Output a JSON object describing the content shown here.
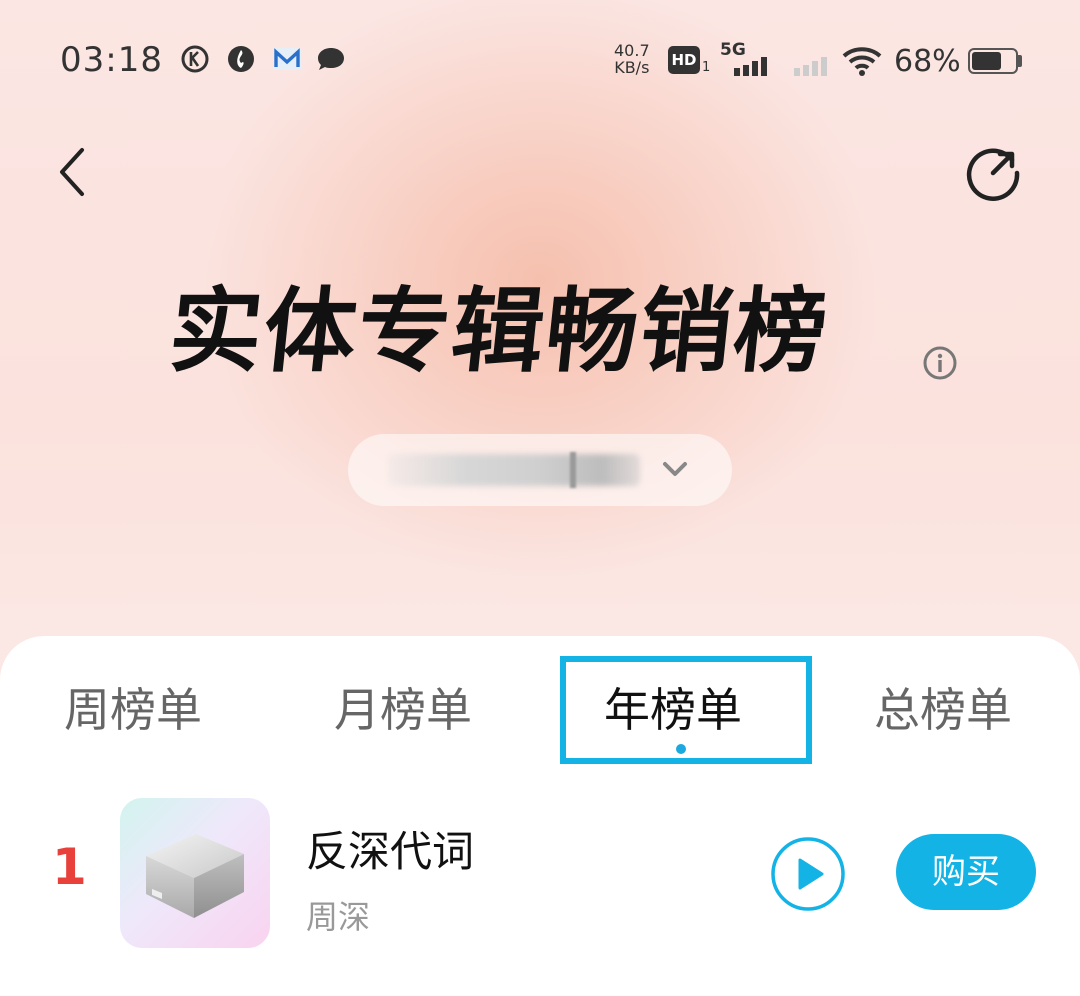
{
  "status_bar": {
    "time": "03:18",
    "net_speed_value": "40.7",
    "net_speed_unit": "KB/s",
    "hd_label": "HD",
    "hd_sub": "1",
    "network_type": "5G",
    "battery_percent": "68%",
    "battery_level": 0.68,
    "notification_icons": [
      "k-circle-icon",
      "flame-icon",
      "mail-m-icon",
      "chat-bubble-icon"
    ]
  },
  "header": {
    "title": "实体专辑畅销榜",
    "back_icon": "chevron-left-icon",
    "share_icon": "share-arrow-icon",
    "info_icon": "info-icon"
  },
  "selector": {
    "value": "",
    "chevron_icon": "chevron-down-icon"
  },
  "tabs": [
    {
      "label": "周榜单",
      "active": false
    },
    {
      "label": "月榜单",
      "active": false
    },
    {
      "label": "年榜单",
      "active": true
    },
    {
      "label": "总榜单",
      "active": false
    }
  ],
  "chart_list": [
    {
      "rank": "1",
      "title": "反深代词",
      "artist": "周深",
      "buy_label": "购买"
    }
  ],
  "colors": {
    "accent": "#14b3e6",
    "rank_red": "#e8403b",
    "hero_pink": "#fbe6e3"
  }
}
